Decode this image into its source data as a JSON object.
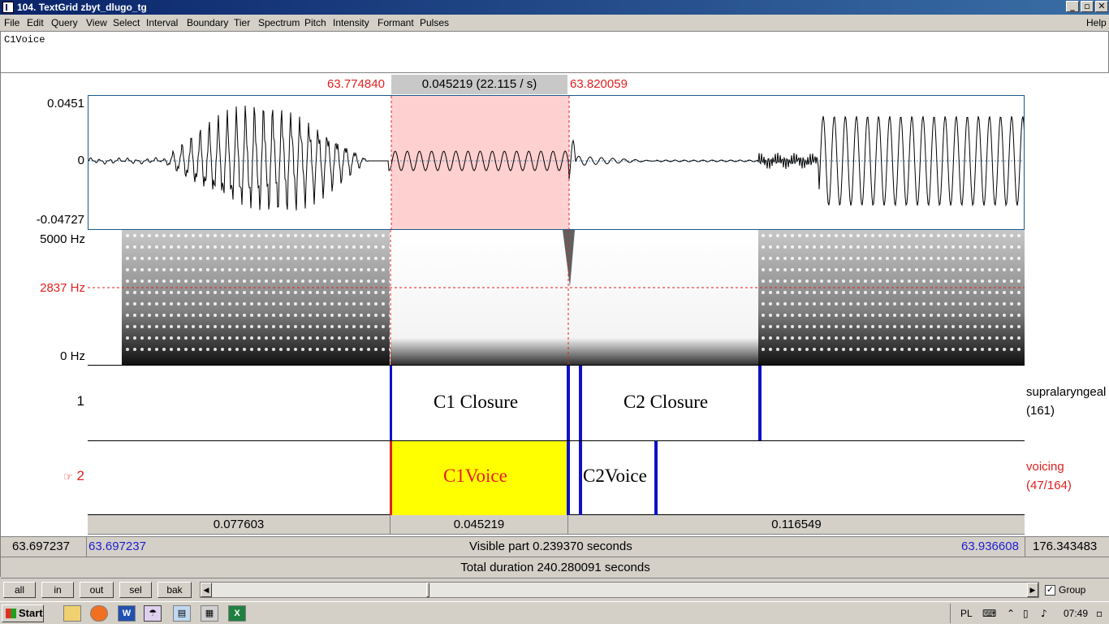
{
  "window": {
    "title": "104. TextGrid zbyt_dlugo_tg"
  },
  "menu": [
    "File",
    "Edit",
    "Query",
    "View",
    "Select",
    "Interval",
    "Boundary",
    "Tier",
    "Spectrum",
    "Pitch",
    "Intensity",
    "Formant",
    "Pulses"
  ],
  "help_label": "Help",
  "text_field": {
    "value": "C1Voice"
  },
  "selection": {
    "start": "63.774840",
    "duration": "0.045219 (22.115 / s)",
    "end": "63.820059"
  },
  "waveform": {
    "max_label": "0.0451",
    "zero_label": "0",
    "min_label": "-0.04727"
  },
  "spectrogram": {
    "top_label": "5000 Hz",
    "cursor_label": "2837 Hz",
    "bottom_label": "0 Hz"
  },
  "tiers": [
    {
      "number": "1",
      "name": "supralaryngeal",
      "count": "(161)",
      "intervals": [
        "C1 Closure",
        "C2 Closure"
      ]
    },
    {
      "number": "2",
      "pointer": "☞",
      "name": "voicing",
      "count": "(47/164)",
      "intervals": [
        "C1Voice",
        "C2Voice"
      ]
    }
  ],
  "durations": [
    "0.077603",
    "0.045219",
    "0.116549"
  ],
  "visible": {
    "window_start": "63.697237",
    "start": "63.697237",
    "label": "Visible part 0.239370 seconds",
    "end": "63.936608",
    "remaining": "176.343483"
  },
  "total": "Total duration 240.280091 seconds",
  "buttons": [
    "all",
    "in",
    "out",
    "sel",
    "bak"
  ],
  "group_label": "Group",
  "group_checked": true,
  "taskbar": {
    "start_label": "Start",
    "language": "PL",
    "time": "07:49"
  },
  "colors": {
    "selection_red": "#e02020",
    "boundary_blue": "#1010c8",
    "selected_interval": "#ffff00",
    "selection_fill": "#ffd0d0"
  }
}
